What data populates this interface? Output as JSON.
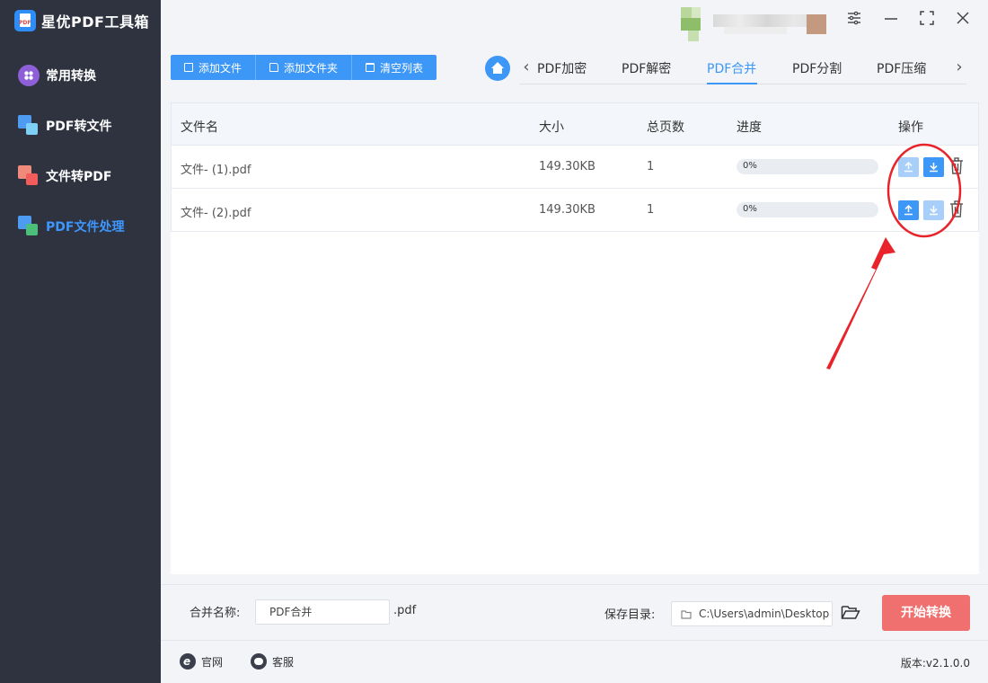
{
  "app": {
    "title": "星优PDF工具箱"
  },
  "sidebar": {
    "items": [
      {
        "label": "常用转换",
        "icon": "grid-circle-icon",
        "active": false
      },
      {
        "label": "PDF转文件",
        "icon": "pdf-to-file-icon",
        "active": false
      },
      {
        "label": "文件转PDF",
        "icon": "file-to-pdf-icon",
        "active": false
      },
      {
        "label": "PDF文件处理",
        "icon": "pdf-process-icon",
        "active": true
      }
    ]
  },
  "window_controls": {
    "settings": "settings-sliders-icon",
    "minimize": "minimize-icon",
    "maximize": "maximize-icon",
    "close": "close-icon"
  },
  "toolbar": {
    "add_file": "添加文件",
    "add_folder": "添加文件夹",
    "clear_list": "清空列表"
  },
  "tabs": {
    "items": [
      "PDF加密",
      "PDF解密",
      "PDF合并",
      "PDF分割",
      "PDF压缩"
    ],
    "active": "PDF合并"
  },
  "table": {
    "headers": {
      "name": "文件名",
      "size": "大小",
      "pages": "总页数",
      "progress": "进度",
      "actions": "操作"
    },
    "rows": [
      {
        "name": "文件- (1).pdf",
        "size": "149.30KB",
        "pages": "1",
        "progress": 0,
        "progress_text": "0%",
        "up_enabled": false,
        "down_enabled": true
      },
      {
        "name": "文件- (2).pdf",
        "size": "149.30KB",
        "pages": "1",
        "progress": 0,
        "progress_text": "0%",
        "up_enabled": true,
        "down_enabled": false
      }
    ]
  },
  "bottom": {
    "merge_name_label": "合并名称:",
    "merge_name_value": "PDF合并",
    "merge_ext": ".pdf",
    "save_dir_label": "保存目录:",
    "save_dir_value": "C:\\Users\\admin\\Desktop",
    "start_button": "开始转换"
  },
  "footer": {
    "website": "官网",
    "service": "客服",
    "version": "版本:v2.1.0.0"
  },
  "colors": {
    "accent": "#3d97f7",
    "sidebar_bg": "#2f3340",
    "start_button": "#f07070",
    "annotation": "#e8242a"
  }
}
